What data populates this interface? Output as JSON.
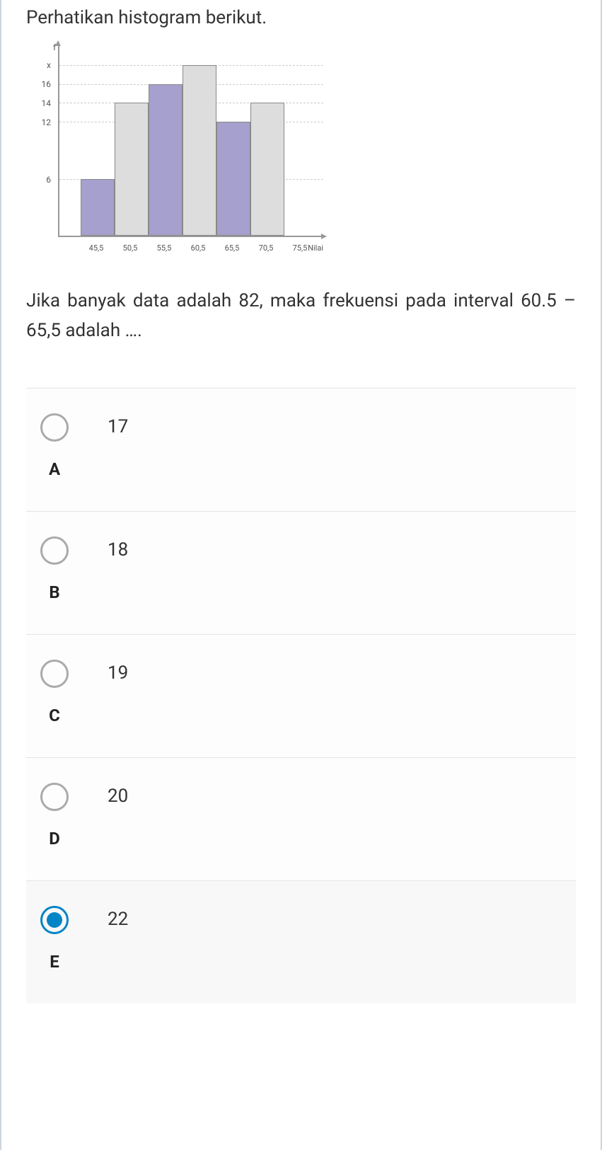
{
  "question": {
    "intro": "Perhatikan histogram berikut.",
    "text": "Jika banyak data adalah 82, maka frekuensi pada interval 60.5 – 65,5 adalah …."
  },
  "chart_data": {
    "type": "bar",
    "title": "",
    "xlabel": "Nilai",
    "ylabel": "f",
    "y_ticks": [
      "x",
      "16",
      "14",
      "12",
      "6"
    ],
    "y_tick_values": [
      18,
      16,
      14,
      12,
      6
    ],
    "ylim": [
      0,
      20
    ],
    "categories": [
      "45,5",
      "50,5",
      "55,5",
      "60,5",
      "65,5",
      "70,5",
      "75,5"
    ],
    "series": [
      {
        "range": "45,5–50,5",
        "value": 6,
        "color": "purple"
      },
      {
        "range": "50,5–55,5",
        "value": 14,
        "color": "gray"
      },
      {
        "range": "55,5–60,5",
        "value": 16,
        "color": "purple"
      },
      {
        "range": "60,5–65,5",
        "value": 18,
        "color": "gray"
      },
      {
        "range": "65,5–70,5",
        "value": 12,
        "color": "purple"
      },
      {
        "range": "70,5–75,5",
        "value": 14,
        "color": "gray"
      }
    ]
  },
  "options": [
    {
      "letter": "A",
      "text": "17",
      "selected": false
    },
    {
      "letter": "B",
      "text": "18",
      "selected": false
    },
    {
      "letter": "C",
      "text": "19",
      "selected": false
    },
    {
      "letter": "D",
      "text": "20",
      "selected": false
    },
    {
      "letter": "E",
      "text": "22",
      "selected": true
    }
  ]
}
